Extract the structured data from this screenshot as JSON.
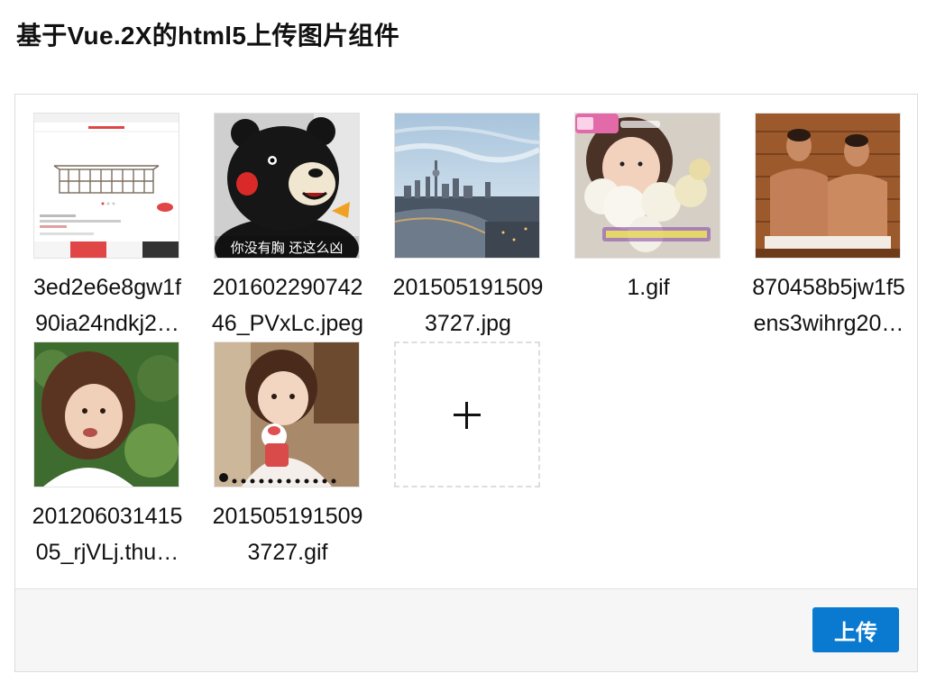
{
  "page": {
    "title": "基于Vue.2X的html5上传图片组件"
  },
  "uploader": {
    "files": [
      {
        "line1": "3ed2e6e8gw1f",
        "line2": "90ia24ndkj2…",
        "thumb": "product-screenshot"
      },
      {
        "line1": "201602290742",
        "line2": "46_PVxLc.jpeg",
        "thumb": "bear-mascot",
        "caption": "你没有胸 还这么凶"
      },
      {
        "line1": "201505191509",
        "line2": "3727.jpg",
        "thumb": "city-skyline"
      },
      {
        "line1": "1.gif",
        "line2": "",
        "thumb": "girl-with-plush"
      },
      {
        "line1": "870458b5jw1f5",
        "line2": "ens3wihrg20…",
        "thumb": "two-men-sauna"
      },
      {
        "line1": "201206031415",
        "line2": "05_rjVLj.thu…",
        "thumb": "girl-portrait"
      },
      {
        "line1": "201505191509",
        "line2": "3727.gif",
        "thumb": "child-drinking"
      }
    ],
    "add_label": "+",
    "upload_button": "上传"
  }
}
